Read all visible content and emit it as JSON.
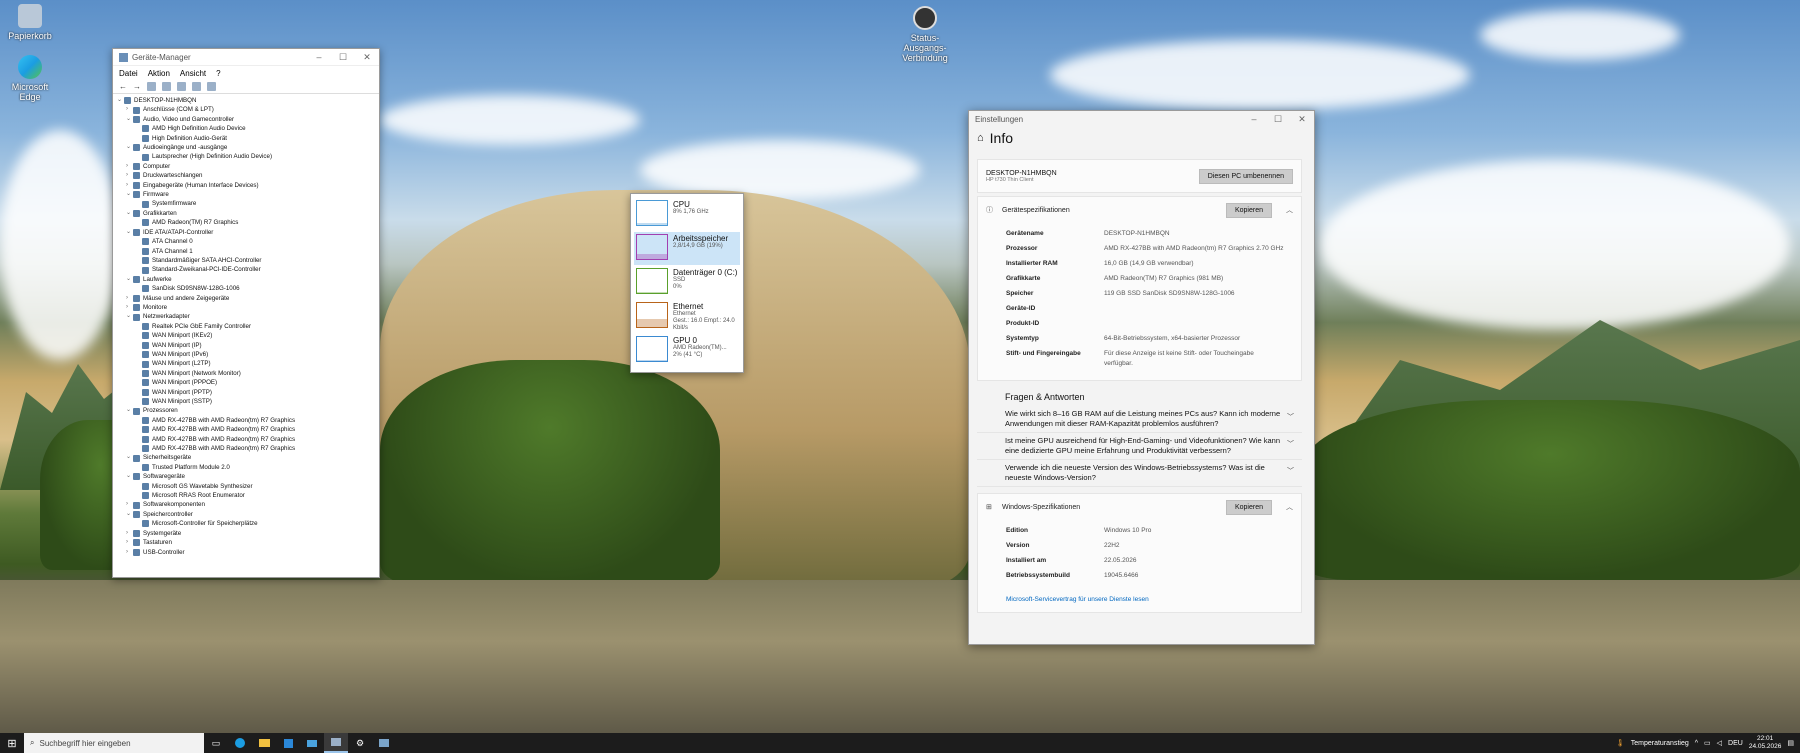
{
  "desktop": {
    "icons": [
      {
        "label": "Papierkorb"
      },
      {
        "label": "Microsoft Edge"
      },
      {
        "label": "Status-Ausgangs-Verbindung"
      }
    ]
  },
  "device_manager": {
    "title": "Geräte-Manager",
    "menu": [
      "Datei",
      "Aktion",
      "Ansicht",
      "?"
    ],
    "tree": [
      {
        "exp": "⌄",
        "label": "DESKTOP-N1HMBQN",
        "indent": 0
      },
      {
        "exp": "›",
        "label": "Anschlüsse (COM & LPT)",
        "indent": 1
      },
      {
        "exp": "⌄",
        "label": "Audio, Video und Gamecontroller",
        "indent": 1
      },
      {
        "exp": "",
        "label": "AMD High Definition Audio Device",
        "indent": 2
      },
      {
        "exp": "",
        "label": "High Definition Audio-Gerät",
        "indent": 2
      },
      {
        "exp": "⌄",
        "label": "Audioeingänge und -ausgänge",
        "indent": 1
      },
      {
        "exp": "",
        "label": "Lautsprecher (High Definition Audio Device)",
        "indent": 2
      },
      {
        "exp": "›",
        "label": "Computer",
        "indent": 1
      },
      {
        "exp": "›",
        "label": "Druckwarteschlangen",
        "indent": 1
      },
      {
        "exp": "›",
        "label": "Eingabegeräte (Human Interface Devices)",
        "indent": 1
      },
      {
        "exp": "⌄",
        "label": "Firmware",
        "indent": 1
      },
      {
        "exp": "",
        "label": "Systemfirmware",
        "indent": 2
      },
      {
        "exp": "⌄",
        "label": "Grafikkarten",
        "indent": 1
      },
      {
        "exp": "",
        "label": "AMD Radeon(TM) R7 Graphics",
        "indent": 2
      },
      {
        "exp": "⌄",
        "label": "IDE ATA/ATAPI-Controller",
        "indent": 1
      },
      {
        "exp": "",
        "label": "ATA Channel 0",
        "indent": 2
      },
      {
        "exp": "",
        "label": "ATA Channel 1",
        "indent": 2
      },
      {
        "exp": "",
        "label": "Standardmäßiger SATA AHCI-Controller",
        "indent": 2
      },
      {
        "exp": "",
        "label": "Standard-Zweikanal-PCI-IDE-Controller",
        "indent": 2
      },
      {
        "exp": "⌄",
        "label": "Laufwerke",
        "indent": 1
      },
      {
        "exp": "",
        "label": "SanDisk SD9SN8W-128G-1006",
        "indent": 2
      },
      {
        "exp": "›",
        "label": "Mäuse und andere Zeigegeräte",
        "indent": 1
      },
      {
        "exp": "›",
        "label": "Monitore",
        "indent": 1
      },
      {
        "exp": "⌄",
        "label": "Netzwerkadapter",
        "indent": 1
      },
      {
        "exp": "",
        "label": "Realtek PCIe GbE Family Controller",
        "indent": 2
      },
      {
        "exp": "",
        "label": "WAN Miniport (IKEv2)",
        "indent": 2
      },
      {
        "exp": "",
        "label": "WAN Miniport (IP)",
        "indent": 2
      },
      {
        "exp": "",
        "label": "WAN Miniport (IPv6)",
        "indent": 2
      },
      {
        "exp": "",
        "label": "WAN Miniport (L2TP)",
        "indent": 2
      },
      {
        "exp": "",
        "label": "WAN Miniport (Network Monitor)",
        "indent": 2
      },
      {
        "exp": "",
        "label": "WAN Miniport (PPPOE)",
        "indent": 2
      },
      {
        "exp": "",
        "label": "WAN Miniport (PPTP)",
        "indent": 2
      },
      {
        "exp": "",
        "label": "WAN Miniport (SSTP)",
        "indent": 2
      },
      {
        "exp": "⌄",
        "label": "Prozessoren",
        "indent": 1
      },
      {
        "exp": "",
        "label": "AMD RX-427BB with AMD Radeon(tm) R7 Graphics",
        "indent": 2
      },
      {
        "exp": "",
        "label": "AMD RX-427BB with AMD Radeon(tm) R7 Graphics",
        "indent": 2
      },
      {
        "exp": "",
        "label": "AMD RX-427BB with AMD Radeon(tm) R7 Graphics",
        "indent": 2
      },
      {
        "exp": "",
        "label": "AMD RX-427BB with AMD Radeon(tm) R7 Graphics",
        "indent": 2
      },
      {
        "exp": "⌄",
        "label": "Sicherheitsgeräte",
        "indent": 1
      },
      {
        "exp": "",
        "label": "Trusted Platform Module 2.0",
        "indent": 2
      },
      {
        "exp": "⌄",
        "label": "Softwaregeräte",
        "indent": 1
      },
      {
        "exp": "",
        "label": "Microsoft GS Wavetable Synthesizer",
        "indent": 2
      },
      {
        "exp": "",
        "label": "Microsoft RRAS Root Enumerator",
        "indent": 2
      },
      {
        "exp": "›",
        "label": "Softwarekomponenten",
        "indent": 1
      },
      {
        "exp": "⌄",
        "label": "Speichercontroller",
        "indent": 1
      },
      {
        "exp": "",
        "label": "Microsoft-Controller für Speicherplätze",
        "indent": 2
      },
      {
        "exp": "›",
        "label": "Systemgeräte",
        "indent": 1
      },
      {
        "exp": "›",
        "label": "Tastaturen",
        "indent": 1
      },
      {
        "exp": "›",
        "label": "USB-Controller",
        "indent": 1
      }
    ]
  },
  "task_manager": {
    "items": [
      {
        "title": "CPU",
        "sub1": "8%  1,76 GHz",
        "sub2": "",
        "color": "#4a9ad6",
        "level": 0.08,
        "selected": false
      },
      {
        "title": "Arbeitsspeicher",
        "sub1": "2,8/14,9 GB (19%)",
        "sub2": "",
        "color": "#a23fb0",
        "level": 0.19,
        "selected": true
      },
      {
        "title": "Datenträger 0 (C:)",
        "sub1": "SSD",
        "sub2": "0%",
        "color": "#5aa02c",
        "level": 0.0,
        "selected": false
      },
      {
        "title": "Ethernet",
        "sub1": "Ethernet",
        "sub2": "Gest.: 16.0  Empf.: 24.0 Kbit/s",
        "color": "#b8641a",
        "level": 0.35,
        "selected": false
      },
      {
        "title": "GPU 0",
        "sub1": "AMD Radeon(TM)...",
        "sub2": "2%  (41 °C)",
        "color": "#3b8ad1",
        "level": 0.02,
        "selected": false
      }
    ]
  },
  "settings": {
    "title": "Einstellungen",
    "page_title": "Info",
    "pc_name": "DESKTOP-N1HMBQN",
    "pc_model": "HP t730 Thin Client",
    "rename_btn": "Diesen PC umbenennen",
    "device_specs_title": "Gerätespezifikationen",
    "copy_label": "Kopieren",
    "device_specs": [
      {
        "k": "Gerätename",
        "v": "DESKTOP-N1HMBQN"
      },
      {
        "k": "Prozessor",
        "v": "AMD RX-427BB with AMD Radeon(tm) R7 Graphics 2.70 GHz"
      },
      {
        "k": "Installierter RAM",
        "v": "16,0 GB (14,9 GB verwendbar)"
      },
      {
        "k": "Grafikkarte",
        "v": "AMD Radeon(TM) R7 Graphics (981 MB)"
      },
      {
        "k": "Speicher",
        "v": "119 GB SSD SanDisk SD9SN8W-128G-1006"
      },
      {
        "k": "Geräte-ID",
        "v": ""
      },
      {
        "k": "Produkt-ID",
        "v": ""
      },
      {
        "k": "Systemtyp",
        "v": "64-Bit-Betriebssystem, x64-basierter Prozessor"
      },
      {
        "k": "Stift- und Fingereingabe",
        "v": "Für diese Anzeige ist keine Stift- oder Toucheingabe verfügbar."
      }
    ],
    "faq_title": "Fragen & Antworten",
    "faqs": [
      "Wie wirkt sich 8–16 GB RAM auf die Leistung meines PCs aus? Kann ich moderne Anwendungen mit dieser RAM-Kapazität problemlos ausführen?",
      "Ist meine GPU ausreichend für High-End-Gaming- und Videofunktionen? Wie kann eine dedizierte GPU meine Erfahrung und Produktivität verbessern?",
      "Verwende ich die neueste Version des Windows-Betriebssystems? Was ist die neueste Windows-Version?"
    ],
    "win_specs_title": "Windows-Spezifikationen",
    "win_specs": [
      {
        "k": "Edition",
        "v": "Windows 10 Pro"
      },
      {
        "k": "Version",
        "v": "22H2"
      },
      {
        "k": "Installiert am",
        "v": "22.05.2026"
      },
      {
        "k": "Betriebssystembuild",
        "v": "19045.6466"
      }
    ],
    "service_link": "Microsoft-Servicevertrag für unsere Dienste lesen"
  },
  "taskbar": {
    "search_placeholder": "Suchbegriff hier eingeben",
    "tray_text": "Temperaturanstieg",
    "lang": "DEU",
    "time": "22:01",
    "date": "24.05.2026"
  }
}
